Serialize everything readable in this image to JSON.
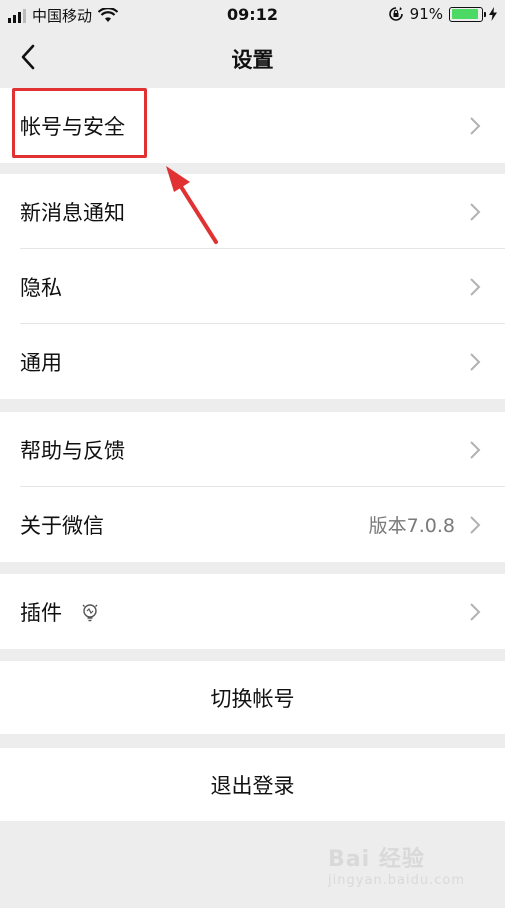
{
  "status_bar": {
    "carrier": "中国移动",
    "time": "09:12",
    "battery_percent": "91%",
    "battery_level": 0.91
  },
  "nav": {
    "title": "设置"
  },
  "groups": {
    "account": {
      "label": "帐号与安全"
    },
    "notify": {
      "label": "新消息通知"
    },
    "privacy": {
      "label": "隐私"
    },
    "general": {
      "label": "通用"
    },
    "help": {
      "label": "帮助与反馈"
    },
    "about": {
      "label": "关于微信",
      "value": "版本7.0.8"
    },
    "plugin": {
      "label": "插件"
    },
    "switch_account": {
      "label": "切换帐号"
    },
    "logout": {
      "label": "退出登录"
    }
  },
  "watermark": {
    "text": "Bai 经验",
    "sub": "jingyan.baidu.com"
  },
  "colors": {
    "highlight": "#e03232",
    "battery": "#4cd964",
    "background": "#ededed"
  }
}
